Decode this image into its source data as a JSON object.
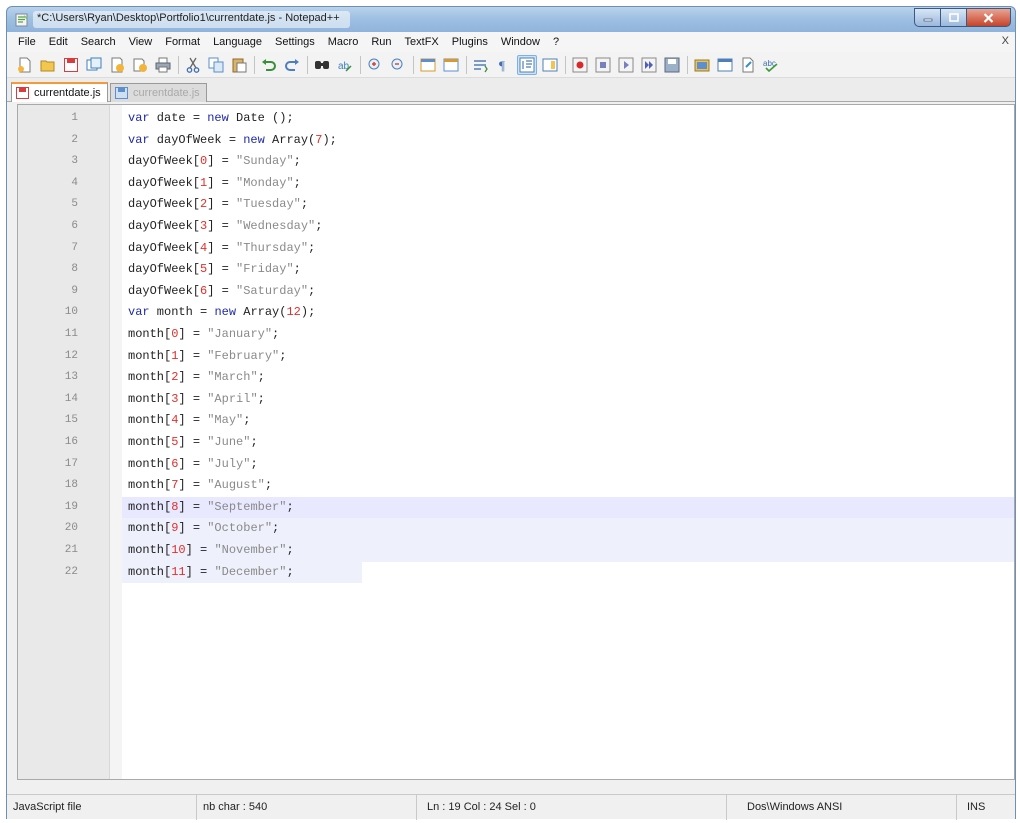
{
  "window": {
    "title": "*C:\\Users\\Ryan\\Desktop\\Portfolio1\\currentdate.js - Notepad++"
  },
  "menubar": {
    "items": [
      "File",
      "Edit",
      "Search",
      "View",
      "Format",
      "Language",
      "Settings",
      "Macro",
      "Run",
      "TextFX",
      "Plugins",
      "Window",
      "?"
    ],
    "close_label": "X"
  },
  "toolbar": {
    "icons": [
      "new-icon",
      "open-icon",
      "save-icon",
      "save-all-icon",
      "close-icon",
      "close-all-icon",
      "print-icon",
      "cut-icon",
      "copy-icon",
      "paste-icon",
      "undo-icon",
      "redo-icon",
      "find-icon",
      "replace-icon",
      "zoom-in-icon",
      "zoom-out-icon",
      "sync-v-icon",
      "sync-h-icon",
      "wrap-icon",
      "all-chars-icon",
      "indent-guide-icon",
      "doc-map-icon",
      "record-macro-icon",
      "stop-macro-icon",
      "play-macro-icon",
      "run-macro-multi-icon",
      "save-macro-icon",
      "launch-browser-icon",
      "browser2-icon",
      "browser3-icon",
      "spellcheck-icon"
    ]
  },
  "tabs": [
    {
      "label": "currentdate.js",
      "active": true
    },
    {
      "label": "currentdate.js",
      "active": false
    }
  ],
  "editor": {
    "current_line": 19,
    "lines": [
      [
        [
          "kw",
          "var"
        ],
        [
          "plain",
          " date "
        ],
        [
          "op",
          "="
        ],
        [
          "plain",
          " "
        ],
        [
          "kw",
          "new"
        ],
        [
          "plain",
          " Date ()"
        ],
        [
          "op",
          ";"
        ]
      ],
      [
        [
          "kw",
          "var"
        ],
        [
          "plain",
          " dayOfWeek "
        ],
        [
          "op",
          "="
        ],
        [
          "plain",
          " "
        ],
        [
          "kw",
          "new"
        ],
        [
          "plain",
          " Array("
        ],
        [
          "num",
          "7"
        ],
        [
          "plain",
          ")"
        ],
        [
          "op",
          ";"
        ]
      ],
      [
        [
          "plain",
          "dayOfWeek["
        ],
        [
          "num",
          "0"
        ],
        [
          "plain",
          "] "
        ],
        [
          "op",
          "="
        ],
        [
          "plain",
          " "
        ],
        [
          "str",
          "\"Sunday\""
        ],
        [
          "op",
          ";"
        ]
      ],
      [
        [
          "plain",
          "dayOfWeek["
        ],
        [
          "num",
          "1"
        ],
        [
          "plain",
          "] "
        ],
        [
          "op",
          "="
        ],
        [
          "plain",
          " "
        ],
        [
          "str",
          "\"Monday\""
        ],
        [
          "op",
          ";"
        ]
      ],
      [
        [
          "plain",
          "dayOfWeek["
        ],
        [
          "num",
          "2"
        ],
        [
          "plain",
          "] "
        ],
        [
          "op",
          "="
        ],
        [
          "plain",
          " "
        ],
        [
          "str",
          "\"Tuesday\""
        ],
        [
          "op",
          ";"
        ]
      ],
      [
        [
          "plain",
          "dayOfWeek["
        ],
        [
          "num",
          "3"
        ],
        [
          "plain",
          "] "
        ],
        [
          "op",
          "="
        ],
        [
          "plain",
          " "
        ],
        [
          "str",
          "\"Wednesday\""
        ],
        [
          "op",
          ";"
        ]
      ],
      [
        [
          "plain",
          "dayOfWeek["
        ],
        [
          "num",
          "4"
        ],
        [
          "plain",
          "] "
        ],
        [
          "op",
          "="
        ],
        [
          "plain",
          " "
        ],
        [
          "str",
          "\"Thursday\""
        ],
        [
          "op",
          ";"
        ]
      ],
      [
        [
          "plain",
          "dayOfWeek["
        ],
        [
          "num",
          "5"
        ],
        [
          "plain",
          "] "
        ],
        [
          "op",
          "="
        ],
        [
          "plain",
          " "
        ],
        [
          "str",
          "\"Friday\""
        ],
        [
          "op",
          ";"
        ]
      ],
      [
        [
          "plain",
          "dayOfWeek["
        ],
        [
          "num",
          "6"
        ],
        [
          "plain",
          "] "
        ],
        [
          "op",
          "="
        ],
        [
          "plain",
          " "
        ],
        [
          "str",
          "\"Saturday\""
        ],
        [
          "op",
          ";"
        ]
      ],
      [
        [
          "kw",
          "var"
        ],
        [
          "plain",
          " month "
        ],
        [
          "op",
          "="
        ],
        [
          "plain",
          " "
        ],
        [
          "kw",
          "new"
        ],
        [
          "plain",
          " Array("
        ],
        [
          "num",
          "12"
        ],
        [
          "plain",
          ")"
        ],
        [
          "op",
          ";"
        ]
      ],
      [
        [
          "plain",
          "month["
        ],
        [
          "num",
          "0"
        ],
        [
          "plain",
          "] "
        ],
        [
          "op",
          "="
        ],
        [
          "plain",
          " "
        ],
        [
          "str",
          "\"January\""
        ],
        [
          "op",
          ";"
        ]
      ],
      [
        [
          "plain",
          "month["
        ],
        [
          "num",
          "1"
        ],
        [
          "plain",
          "] "
        ],
        [
          "op",
          "="
        ],
        [
          "plain",
          " "
        ],
        [
          "str",
          "\"February\""
        ],
        [
          "op",
          ";"
        ]
      ],
      [
        [
          "plain",
          "month["
        ],
        [
          "num",
          "2"
        ],
        [
          "plain",
          "] "
        ],
        [
          "op",
          "="
        ],
        [
          "plain",
          " "
        ],
        [
          "str",
          "\"March\""
        ],
        [
          "op",
          ";"
        ]
      ],
      [
        [
          "plain",
          "month["
        ],
        [
          "num",
          "3"
        ],
        [
          "plain",
          "] "
        ],
        [
          "op",
          "="
        ],
        [
          "plain",
          " "
        ],
        [
          "str",
          "\"April\""
        ],
        [
          "op",
          ";"
        ]
      ],
      [
        [
          "plain",
          "month["
        ],
        [
          "num",
          "4"
        ],
        [
          "plain",
          "] "
        ],
        [
          "op",
          "="
        ],
        [
          "plain",
          " "
        ],
        [
          "str",
          "\"May\""
        ],
        [
          "op",
          ";"
        ]
      ],
      [
        [
          "plain",
          "month["
        ],
        [
          "num",
          "5"
        ],
        [
          "plain",
          "] "
        ],
        [
          "op",
          "="
        ],
        [
          "plain",
          " "
        ],
        [
          "str",
          "\"June\""
        ],
        [
          "op",
          ";"
        ]
      ],
      [
        [
          "plain",
          "month["
        ],
        [
          "num",
          "6"
        ],
        [
          "plain",
          "] "
        ],
        [
          "op",
          "="
        ],
        [
          "plain",
          " "
        ],
        [
          "str",
          "\"July\""
        ],
        [
          "op",
          ";"
        ]
      ],
      [
        [
          "plain",
          "month["
        ],
        [
          "num",
          "7"
        ],
        [
          "plain",
          "] "
        ],
        [
          "op",
          "="
        ],
        [
          "plain",
          " "
        ],
        [
          "str",
          "\"August\""
        ],
        [
          "op",
          ";"
        ]
      ],
      [
        [
          "plain",
          "month["
        ],
        [
          "num",
          "8"
        ],
        [
          "plain",
          "] "
        ],
        [
          "op",
          "="
        ],
        [
          "plain",
          " "
        ],
        [
          "str",
          "\"September\""
        ],
        [
          "op",
          ";"
        ]
      ],
      [
        [
          "plain",
          "month["
        ],
        [
          "num",
          "9"
        ],
        [
          "plain",
          "] "
        ],
        [
          "op",
          "="
        ],
        [
          "plain",
          " "
        ],
        [
          "str",
          "\"October\""
        ],
        [
          "op",
          ";"
        ]
      ],
      [
        [
          "plain",
          "month["
        ],
        [
          "num",
          "10"
        ],
        [
          "plain",
          "] "
        ],
        [
          "op",
          "="
        ],
        [
          "plain",
          " "
        ],
        [
          "str",
          "\"November\""
        ],
        [
          "op",
          ";"
        ]
      ],
      [
        [
          "plain",
          "month["
        ],
        [
          "num",
          "11"
        ],
        [
          "plain",
          "] "
        ],
        [
          "op",
          "="
        ],
        [
          "plain",
          " "
        ],
        [
          "str",
          "\"December\""
        ],
        [
          "op",
          ";"
        ]
      ]
    ]
  },
  "statusbar": {
    "file_type": "JavaScript file",
    "nb_char": "nb char : 540",
    "position": "Ln : 19    Col : 24    Sel : 0",
    "encoding": "Dos\\Windows  ANSI",
    "mode": "INS"
  },
  "colors": {
    "keyword": "#1f2aa8",
    "number": "#e2302a",
    "string": "#8a8a8a",
    "tab_accent": "#f39a3b"
  }
}
